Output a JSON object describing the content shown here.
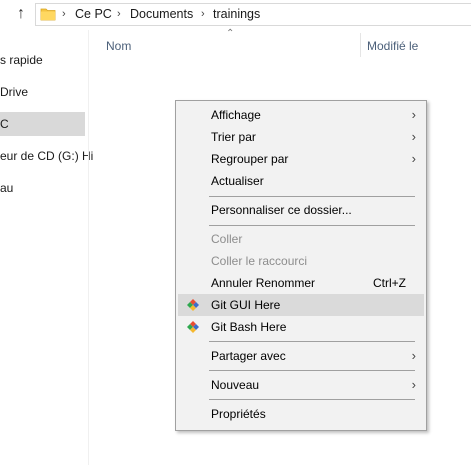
{
  "address_bar": {
    "crumbs": [
      "Ce PC",
      "Documents",
      "trainings"
    ]
  },
  "nav_pane": {
    "items": [
      "s rapide",
      "Drive",
      "C",
      "eur de CD (G:) Hi",
      "au"
    ]
  },
  "columns": {
    "name": "Nom",
    "modified": "Modifié le"
  },
  "context_menu": {
    "affichage": "Affichage",
    "trier": "Trier par",
    "regrouper": "Regrouper par",
    "actualiser": "Actualiser",
    "personnaliser": "Personnaliser ce dossier...",
    "coller": "Coller",
    "coller_raccourci": "Coller le raccourci",
    "annuler": "Annuler Renommer",
    "annuler_shortcut": "Ctrl+Z",
    "git_gui": "Git GUI Here",
    "git_bash": "Git Bash Here",
    "partager": "Partager avec",
    "nouveau": "Nouveau",
    "proprietes": "Propriétés"
  },
  "colors": {
    "accent_selected": "#d9d9d9",
    "menu_bg": "#f2f2f2",
    "git_red": "#e84d31",
    "git_green": "#2fa84f",
    "git_blue": "#3d6cc9",
    "folder_yellow": "#f5c542"
  }
}
